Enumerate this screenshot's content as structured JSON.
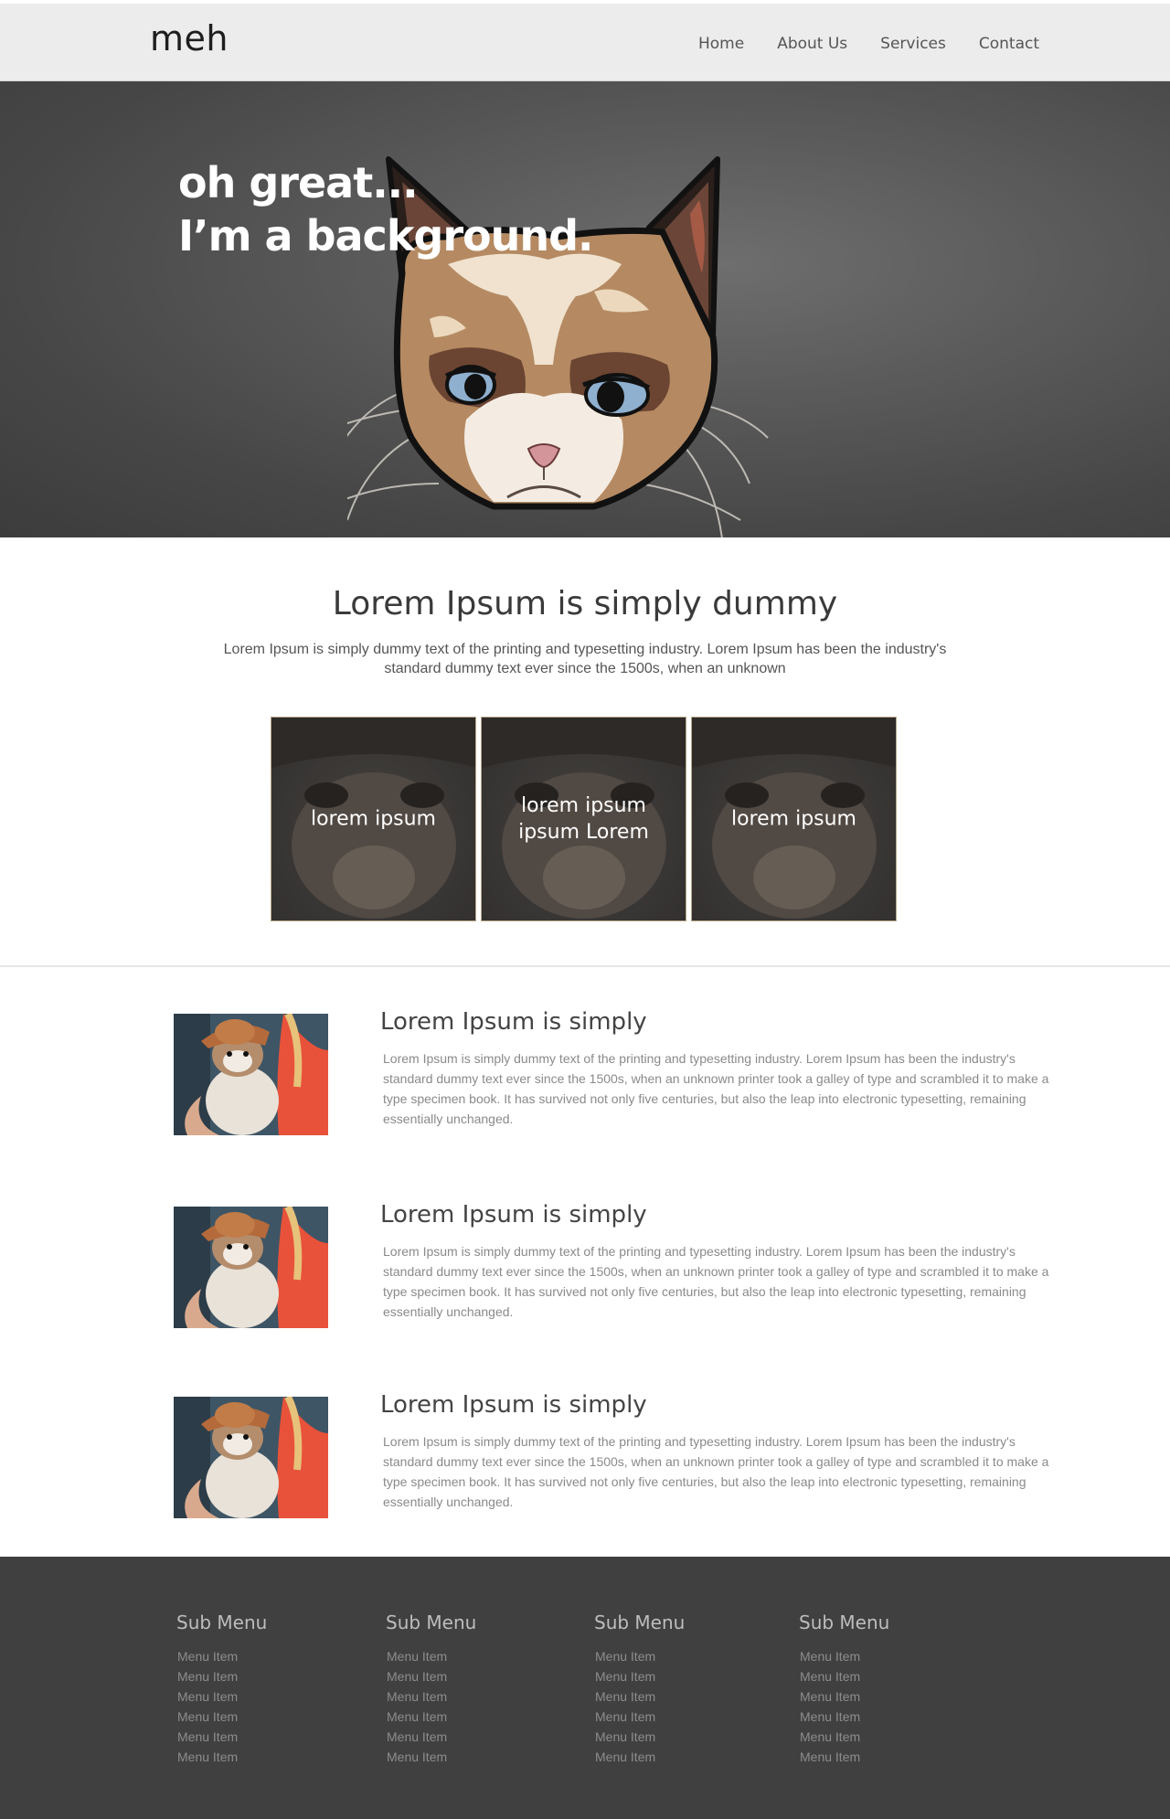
{
  "header": {
    "logo": "meh",
    "nav": [
      {
        "label": "Home"
      },
      {
        "label": "About Us"
      },
      {
        "label": "Services"
      },
      {
        "label": "Contact"
      }
    ]
  },
  "hero": {
    "line1": "oh great...",
    "line2": "I’m a background."
  },
  "intro": {
    "heading": "Lorem Ipsum is simply dummy",
    "text": "Lorem Ipsum is simply dummy text of the printing and typesetting industry. Lorem Ipsum has been the industry's standard dummy text ever since the 1500s, when an unknown"
  },
  "tiles": [
    {
      "label": "lorem ipsum"
    },
    {
      "label": "lorem ipsum ipsum Lorem"
    },
    {
      "label": "lorem ipsum"
    }
  ],
  "articles": [
    {
      "title": "Lorem Ipsum is simply",
      "text": "Lorem Ipsum is simply dummy text of the printing and typesetting industry. Lorem Ipsum has been the industry's standard dummy text ever since the 1500s, when an unknown printer took a galley of type and scrambled it to make a type specimen book. It has survived not only five centuries, but also the leap into electronic typesetting, remaining essentially unchanged."
    },
    {
      "title": "Lorem Ipsum is simply",
      "text": "Lorem Ipsum is simply dummy text of the printing and typesetting industry. Lorem Ipsum has been the industry's standard dummy text ever since the 1500s, when an unknown printer took a galley of type and scrambled it to make a type specimen book. It has survived not only five centuries, but also the leap into electronic typesetting, remaining essentially unchanged."
    },
    {
      "title": "Lorem Ipsum is simply",
      "text": "Lorem Ipsum is simply dummy text of the printing and typesetting industry. Lorem Ipsum has been the industry's standard dummy text ever since the 1500s, when an unknown printer took a galley of type and scrambled it to make a type specimen book. It has survived not only five centuries, but also the leap into electronic typesetting, remaining essentially unchanged."
    }
  ],
  "footer": {
    "columns": [
      {
        "title": "Sub Menu",
        "items": [
          "Menu Item",
          "Menu Item",
          "Menu Item",
          "Menu Item",
          "Menu Item",
          "Menu Item"
        ]
      },
      {
        "title": "Sub Menu",
        "items": [
          "Menu Item",
          "Menu Item",
          "Menu Item",
          "Menu Item",
          "Menu Item",
          "Menu Item"
        ]
      },
      {
        "title": "Sub Menu",
        "items": [
          "Menu Item",
          "Menu Item",
          "Menu Item",
          "Menu Item",
          "Menu Item",
          "Menu Item"
        ]
      },
      {
        "title": "Sub Menu",
        "items": [
          "Menu Item",
          "Menu Item",
          "Menu Item",
          "Menu Item",
          "Menu Item",
          "Menu Item"
        ]
      }
    ]
  },
  "colors": {
    "header_bg": "#ececec",
    "hero_bg": "#555555",
    "footer_bg": "#404040",
    "heading_text": "#3a3a3a",
    "body_text": "#8a8a8a"
  }
}
